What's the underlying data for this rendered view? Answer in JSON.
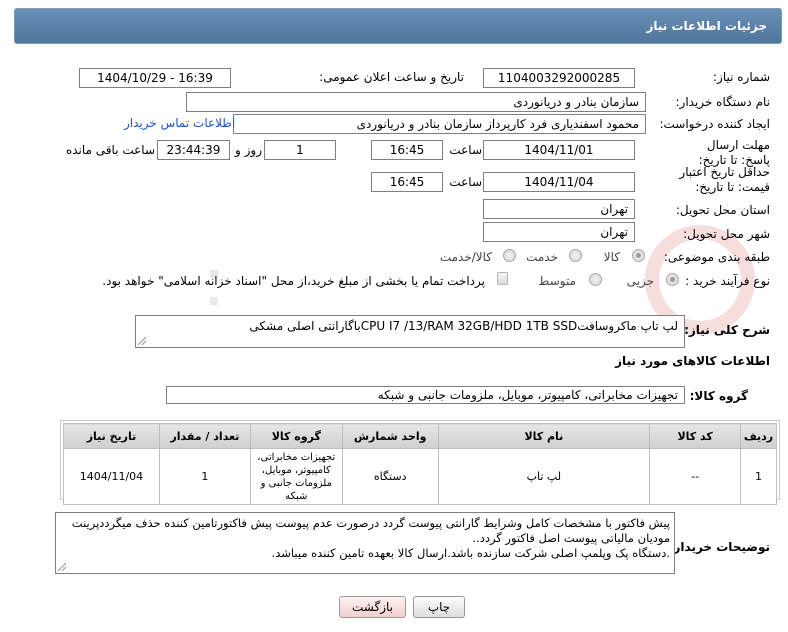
{
  "header": {
    "title": "جزئیات اطلاعات نیاز"
  },
  "form": {
    "need_number_label": "شماره نیاز:",
    "need_number": "1104003292000285",
    "announce_label": "تاریخ و ساعت اعلان عمومی:",
    "announce_value": "1404/10/29 - 16:39",
    "buyer_org_label": "نام دستگاه خریدار:",
    "buyer_org": "سازمان بنادر و دریانوردی",
    "creator_label": "ایجاد کننده درخواست:",
    "creator": "محمود اسفندیاری فرد کارپرداز سازمان بنادر و دریانوردی",
    "contact_link": "اطلاعات تماس خریدار",
    "deadline_label": "مهلت ارسال پاسخ: تا تاریخ:",
    "deadline_date": "1404/11/01",
    "time_label": "ساعت",
    "deadline_time": "16:45",
    "days_value": "1",
    "days_label": "روز و",
    "remaining_time": "23:44:39",
    "remaining_label": "ساعت باقی مانده",
    "price_label": "حداقل تاریخ اعتبار قیمت: تا تاریخ:",
    "price_date": "1404/11/04",
    "price_time": "16:45",
    "province_label": "استان محل تحویل:",
    "province": "تهران",
    "city_label": "شهر محل تحویل:",
    "city": "تهران",
    "category_label": "طبقه بندی موضوعی:",
    "category_options": [
      "کالا",
      "خدمت",
      "کالا/خدمت"
    ],
    "process_label": "نوع فرآیند خرید :",
    "process_options": [
      "جزیی",
      "متوسط"
    ],
    "payment_note": "پرداخت تمام یا بخشی از مبلغ خرید،از محل \"اسناد خزانه اسلامی\" خواهد بود."
  },
  "summary": {
    "label": "شرح کلی نیاز:",
    "text": "لپ تاپ ماکروسافتCPU I7 /13/RAM 32GB/HDD 1TB SSDباگارانتی اصلی مشکی"
  },
  "goods": {
    "section_title": "اطلاعات کالاهای مورد نیاز",
    "group_label": "گروه کالا:",
    "group_value": "تجهیزات مخابراتی، کامپیوتر، موبایل، ملزومات جانبی و شبکه"
  },
  "table": {
    "headers": [
      "ردیف",
      "کد کالا",
      "نام کالا",
      "واحد شمارش",
      "گروه کالا",
      "تعداد / مقدار",
      "تاریخ نیاز"
    ],
    "rows": [
      [
        "1",
        "--",
        "لپ تاپ",
        "دستگاه",
        "تجهیزات مخابراتی، کامپیوتر، موبایل، ملزومات جانبی و شبکه",
        "1",
        "1404/11/04"
      ]
    ]
  },
  "buyer_notes": {
    "label": "توضیحات خریدار:",
    "line1": "پیش فاکتور با مشخصات کامل وشرایط گارانتی پیوست گردد درصورت عدم پیوست پیش فاکتورتامین کننده حذف میگرددپرینت",
    "line2": "مودیان مالیاتی پیوست اصل فاکتور گردد..",
    "line3": ".دستگاه پک وپلمپ اصلی شرکت سازنده باشد.ارسال کالا بعهده تامین کننده میباشد."
  },
  "buttons": {
    "print": "چاپ",
    "back": "بازگشت"
  },
  "watermark": {
    "text": "AriaTender.net"
  },
  "colors": {
    "header": "#5a80a8",
    "link": "#1a56c7"
  }
}
